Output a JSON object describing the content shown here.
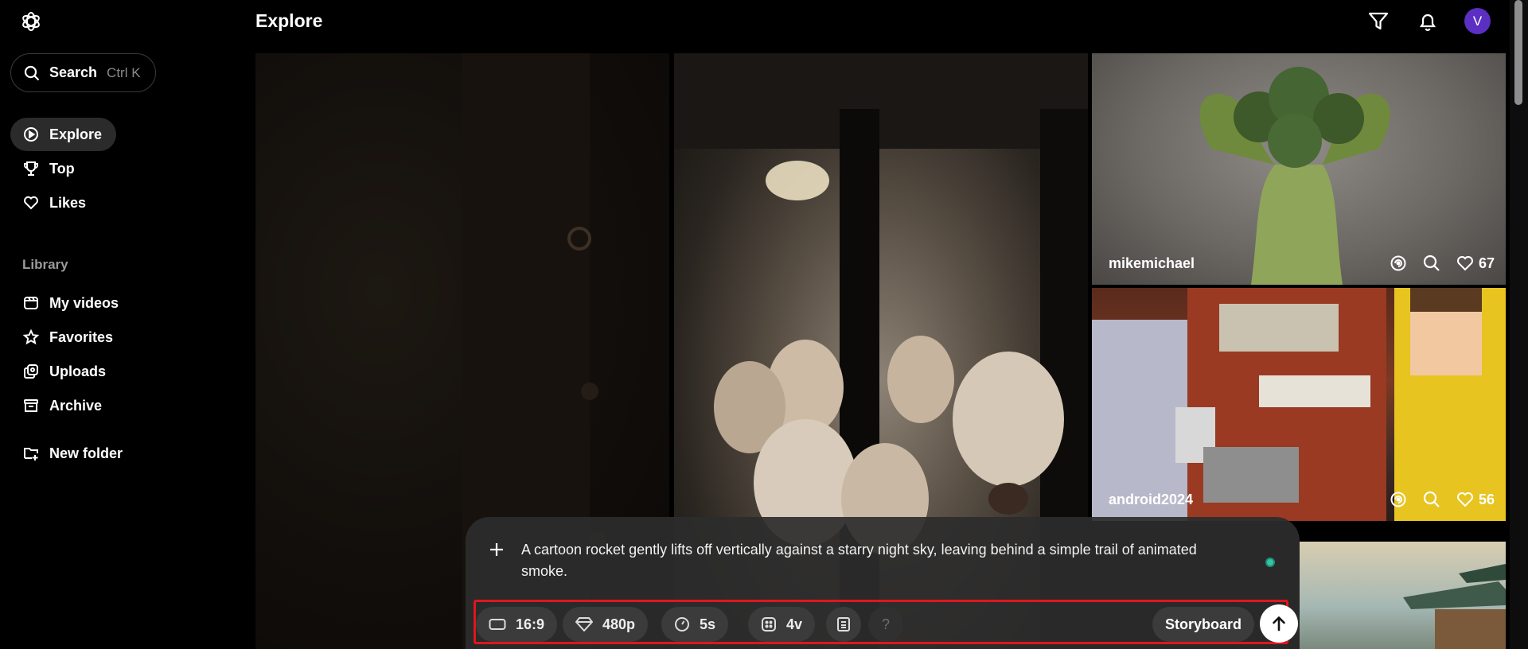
{
  "sidebar": {
    "search": {
      "label": "Search",
      "shortcut": "Ctrl K"
    },
    "nav": [
      {
        "label": "Explore",
        "icon": "explore-icon",
        "active": true
      },
      {
        "label": "Top",
        "icon": "trophy-icon"
      },
      {
        "label": "Likes",
        "icon": "heart-icon"
      }
    ],
    "library_label": "Library",
    "library": [
      {
        "label": "My videos",
        "icon": "video-icon"
      },
      {
        "label": "Favorites",
        "icon": "star-icon"
      },
      {
        "label": "Uploads",
        "icon": "uploads-icon"
      },
      {
        "label": "Archive",
        "icon": "archive-icon"
      }
    ],
    "new_folder": {
      "label": "New folder",
      "icon": "new-folder-icon"
    }
  },
  "header": {
    "title": "Explore",
    "avatar_initial": "V",
    "avatar_color": "#5a2fc2"
  },
  "grid": {
    "tiles": [
      {
        "user": "mikemichael",
        "likes": "67"
      },
      {
        "user": "android2024",
        "likes": "56"
      }
    ]
  },
  "composer": {
    "prompt": "A cartoon rocket gently lifts off vertically against a starry night sky, leaving behind a simple trail of animated smoke.",
    "aspect": "16:9",
    "resolution": "480p",
    "duration": "5s",
    "variations": "4v",
    "help": "?",
    "storyboard": "Storyboard",
    "highlight_color": "#e0161c"
  }
}
